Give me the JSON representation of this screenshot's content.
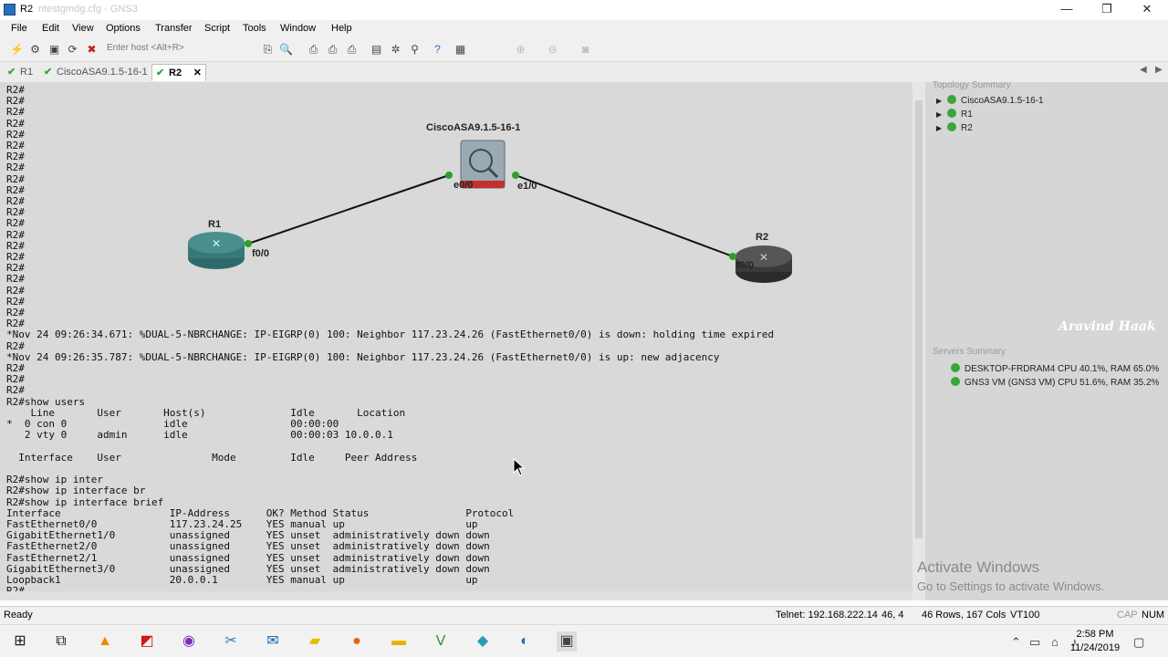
{
  "window": {
    "title": "R2",
    "ghost_title": "ntestgmdg.cfg - GNS3",
    "minimize": "—",
    "restore": "❐",
    "close": "✕"
  },
  "menu": [
    "File",
    "Edit",
    "View",
    "Options",
    "Transfer",
    "Script",
    "Tools",
    "Window",
    "Help"
  ],
  "toolbar": {
    "host_placeholder": "Enter host <Alt+R>"
  },
  "tabs": [
    {
      "label": "R1",
      "active": false
    },
    {
      "label": "CiscoASA9.1.5-16-1",
      "active": false
    },
    {
      "label": "R2",
      "active": true
    }
  ],
  "topology": {
    "nodes": [
      {
        "name": "CiscoASA9.1.5-16-1",
        "type": "firewall"
      },
      {
        "name": "R1",
        "type": "router"
      },
      {
        "name": "R2",
        "type": "router"
      }
    ],
    "interfaces": {
      "asa_e0": "e0/0",
      "asa_e1": "e1/0",
      "r1_f0": "f0/0",
      "r2_f0": "f0/0"
    }
  },
  "terminal": {
    "lines": [
      "R2#",
      "R2#",
      "R2#",
      "R2#",
      "R2#",
      "R2#",
      "R2#",
      "R2#",
      "R2#",
      "R2#",
      "R2#",
      "R2#",
      "R2#",
      "R2#",
      "R2#",
      "R2#",
      "R2#",
      "R2#",
      "R2#",
      "R2#",
      "R2#",
      "R2#",
      "*Nov 24 09:26:34.671: %DUAL-5-NBRCHANGE: IP-EIGRP(0) 100: Neighbor 117.23.24.26 (FastEthernet0/0) is down: holding time expired",
      "R2#",
      "*Nov 24 09:26:35.787: %DUAL-5-NBRCHANGE: IP-EIGRP(0) 100: Neighbor 117.23.24.26 (FastEthernet0/0) is up: new adjacency",
      "R2#",
      "R2#",
      "R2#",
      "R2#show users",
      "    Line       User       Host(s)              Idle       Location",
      "*  0 con 0                idle                 00:00:00",
      "   2 vty 0     admin      idle                 00:00:03 10.0.0.1",
      "",
      "  Interface    User               Mode         Idle     Peer Address",
      "",
      "R2#show ip inter",
      "R2#show ip interface br",
      "R2#show ip interface brief",
      "Interface                  IP-Address      OK? Method Status                Protocol",
      "FastEthernet0/0            117.23.24.25    YES manual up                    up",
      "GigabitEthernet1/0         unassigned      YES unset  administratively down down",
      "FastEthernet2/0            unassigned      YES unset  administratively down down",
      "FastEthernet2/1            unassigned      YES unset  administratively down down",
      "GigabitEthernet3/0         unassigned      YES unset  administratively down down",
      "Loopback1                  20.0.0.1        YES manual up                    up",
      "R2#"
    ]
  },
  "right_panel": {
    "topology_summary_title": "Topology Summary",
    "topology_items": [
      "CiscoASA9.1.5-16-1",
      "R1",
      "R2"
    ],
    "servers_summary_title": "Servers Summary",
    "servers": [
      "DESKTOP-FRDRAM4 CPU 40.1%, RAM 65.0%",
      "GNS3 VM (GNS3 VM) CPU 51.6%, RAM 35.2%"
    ]
  },
  "watermark": "Aravind Haak",
  "activate_windows": {
    "title": "Activate Windows",
    "subtitle": "Go to Settings to activate Windows."
  },
  "status": {
    "ready": "Ready",
    "connection": "Telnet: 192.168.222.14",
    "cursor_pos": "46,  4",
    "size": "46 Rows, 167 Cols",
    "emulation": "VT100",
    "cap": "CAP",
    "num": "NUM"
  },
  "clock": {
    "time": "2:58 PM",
    "date": "11/24/2019"
  },
  "colors": {
    "terminal_bg": "#d9d9d9",
    "link_green": "#2aa02a",
    "taskbar": "#f2f2f2"
  }
}
